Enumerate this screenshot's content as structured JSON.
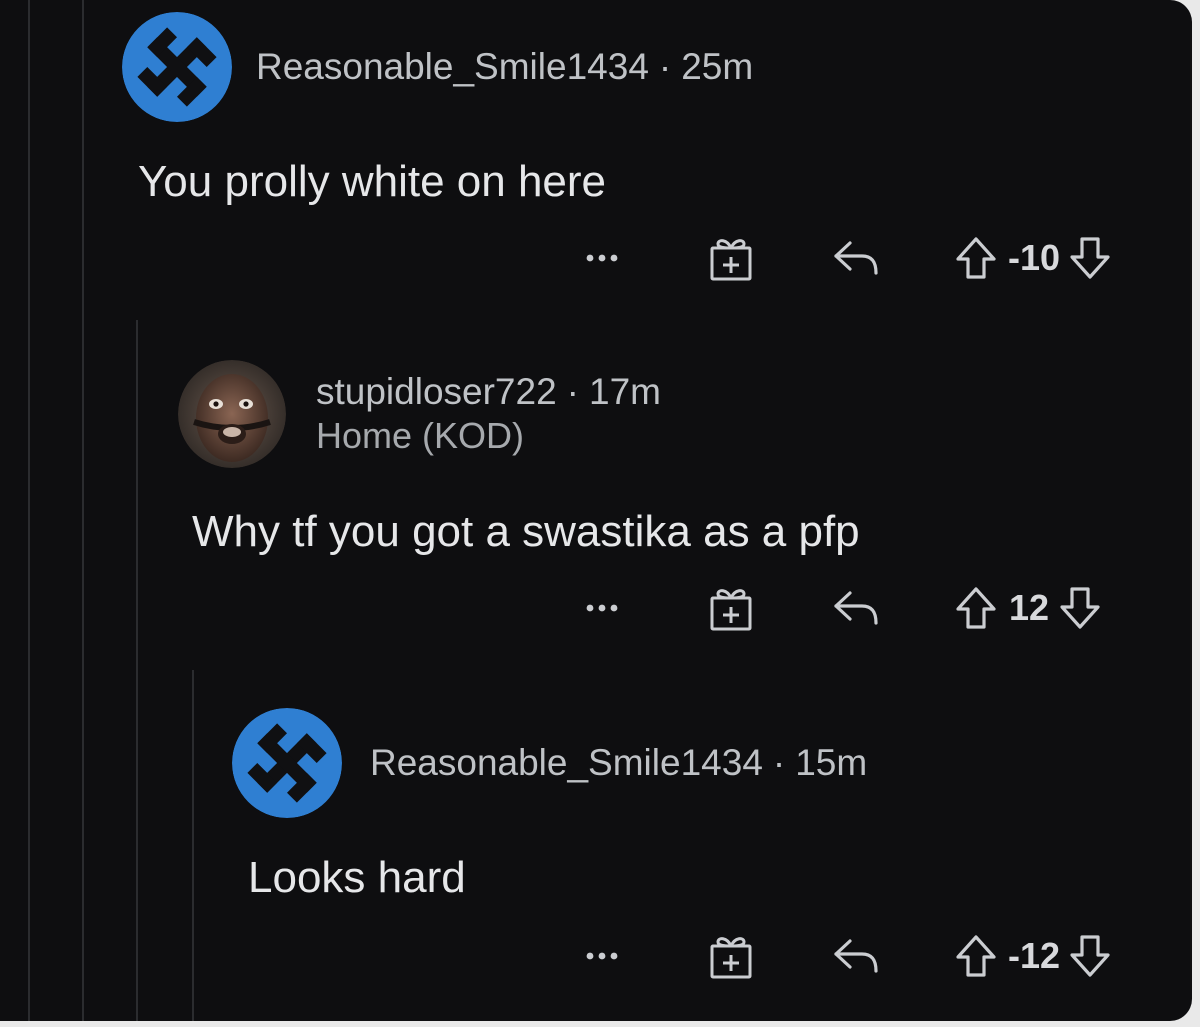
{
  "comments": [
    {
      "username": "Reasonable_Smile1434",
      "separator": "·",
      "time": "25m",
      "flair": "",
      "body": "You prolly white on here",
      "score": "-10",
      "avatar_icon": "swastika-avatar-icon"
    },
    {
      "username": "stupidloser722",
      "separator": "·",
      "time": "17m",
      "flair": "Home (KOD)",
      "body": "Why tf you got a swastika as a pfp",
      "score": "12",
      "avatar_icon": "photo-avatar"
    },
    {
      "username": "Reasonable_Smile1434",
      "separator": "·",
      "time": "15m",
      "flair": "",
      "body": "Looks hard",
      "score": "-12",
      "avatar_icon": "swastika-avatar-icon"
    }
  ],
  "action_icons": [
    "more-options-icon",
    "gift-award-icon",
    "reply-icon",
    "upvote-icon",
    "downvote-icon"
  ],
  "colors": {
    "background": "#0e0e10",
    "avatar_blue": "#2f7fd2",
    "text_primary": "#e6e7e9",
    "text_secondary": "#bfc2c6",
    "thread_line": "#2b2c2f"
  }
}
